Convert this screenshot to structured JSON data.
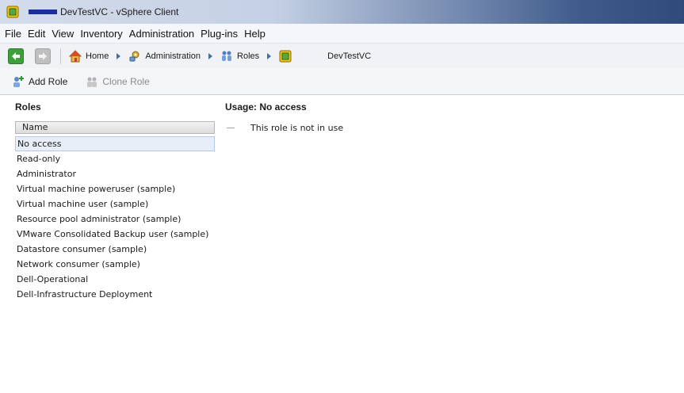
{
  "window": {
    "title": "DevTestVC - vSphere Client"
  },
  "menu": [
    "File",
    "Edit",
    "View",
    "Inventory",
    "Administration",
    "Plug-ins",
    "Help"
  ],
  "breadcrumb": {
    "items": [
      {
        "label": "Home",
        "icon": "home-icon"
      },
      {
        "label": "Administration",
        "icon": "administration-icon"
      },
      {
        "label": "Roles",
        "icon": "roles-icon"
      },
      {
        "label": "DevTestVC",
        "icon": "vcenter-icon"
      }
    ]
  },
  "toolbar": {
    "add_role": "Add Role",
    "clone_role": "Clone Role"
  },
  "roles": {
    "heading": "Roles",
    "column_name": "Name",
    "selected_index": 0,
    "items": [
      "No access",
      "Read-only",
      "Administrator",
      "Virtual machine poweruser (sample)",
      "Virtual machine user (sample)",
      "Resource pool administrator (sample)",
      "VMware Consolidated Backup user (sample)",
      "Datastore consumer (sample)",
      "Network consumer (sample)",
      "Dell-Operational",
      "Dell-Infrastructure Deployment"
    ]
  },
  "usage": {
    "heading": "Usage: No access",
    "message": "This role is not in use"
  }
}
